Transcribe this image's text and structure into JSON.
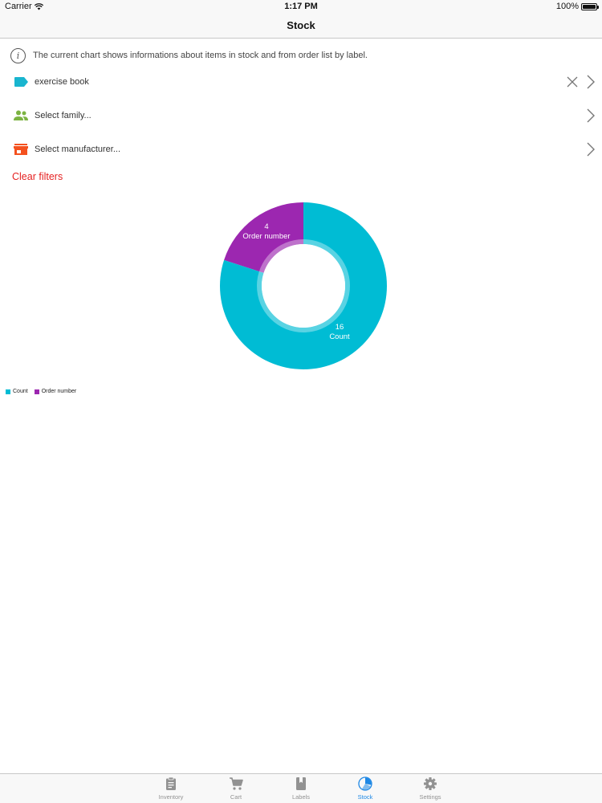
{
  "status_bar": {
    "carrier": "Carrier",
    "time": "1:17 PM",
    "battery": "100%"
  },
  "nav": {
    "title": "Stock"
  },
  "info": {
    "text": "The current chart shows  informations about items in stock and from order list by label."
  },
  "filters": {
    "label": {
      "value": "exercise book",
      "icon": "label-tag-icon",
      "color": "#19b5cf"
    },
    "family": {
      "placeholder": "Select family...",
      "icon": "family-people-icon",
      "color": "#7cb342"
    },
    "manufacturer": {
      "placeholder": "Select manufacturer...",
      "icon": "store-icon",
      "color": "#f4511e"
    }
  },
  "clear_filters": "Clear filters",
  "chart_data": {
    "type": "pie",
    "style": "donut",
    "series": [
      {
        "name": "Count",
        "value": 16,
        "color": "#00bcd4",
        "label_value": "16",
        "label_name": "Count"
      },
      {
        "name": "Order number",
        "value": 4,
        "color": "#9c27b0",
        "label_value": "4",
        "label_name": "Order number"
      }
    ],
    "legend": [
      "Count",
      "Order number"
    ],
    "legend_position": "bottom-left"
  },
  "tabs": [
    {
      "label": "Inventory",
      "icon": "clipboard-icon",
      "active": false
    },
    {
      "label": "Cart",
      "icon": "cart-icon",
      "active": false
    },
    {
      "label": "Labels",
      "icon": "book-icon",
      "active": false
    },
    {
      "label": "Stock",
      "icon": "stock-chart-icon",
      "active": true
    },
    {
      "label": "Settings",
      "icon": "gear-icon",
      "active": false
    }
  ],
  "colors": {
    "active_tab": "#1e88e5",
    "inactive_tab": "#929292",
    "clear_filters": "#e52222"
  }
}
